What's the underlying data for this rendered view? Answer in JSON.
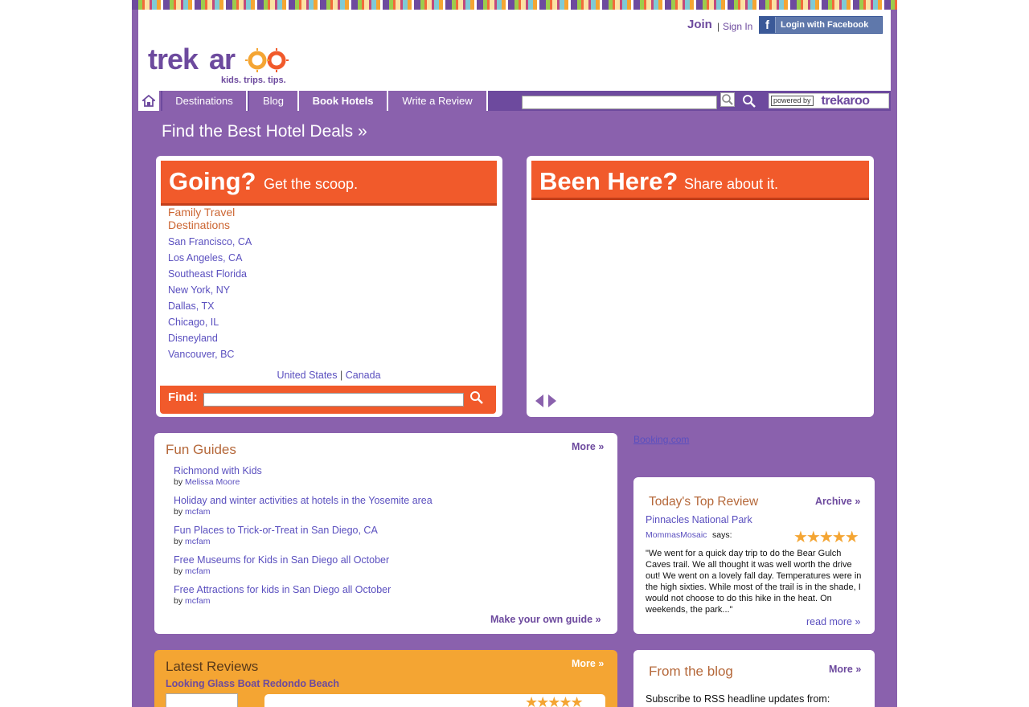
{
  "header": {
    "logo_text": "trekaroo",
    "tagline": "kids. trips. tips.",
    "join_label": "Join",
    "separator": "|",
    "signin_label": "Sign In",
    "facebook_label": "Login with Facebook"
  },
  "nav": {
    "items": [
      {
        "label": "Destinations"
      },
      {
        "label": "Blog"
      },
      {
        "label": "Book Hotels"
      },
      {
        "label": "Write a Review"
      }
    ],
    "search_placeholder": "",
    "powered_by": "powered by",
    "powered_logo": "trekaroo"
  },
  "page": {
    "title": "Find the Best Hotel Deals »"
  },
  "going": {
    "big": "Going?",
    "small": "Get the scoop.",
    "dest_heading": "Family Travel Destinations",
    "destinations": [
      "San Francisco, CA",
      "Los Angeles, CA",
      "Southeast Florida",
      "New York, NY",
      "Dallas, TX",
      "Chicago, IL",
      "Disneyland",
      "Vancouver, BC"
    ],
    "country_us": "United States",
    "country_sep": "|",
    "country_ca": "Canada",
    "find_label": "Find:",
    "find_value": ""
  },
  "been": {
    "big": "Been Here?",
    "small": "Share about it."
  },
  "fun_guides": {
    "heading": "Fun Guides",
    "more": "More »",
    "by": "by",
    "items": [
      {
        "title": "Richmond with Kids",
        "author": "Melissa Moore"
      },
      {
        "title": "Holiday and winter activities at hotels in the Yosemite area",
        "author": "mcfam"
      },
      {
        "title": "Fun Places to Trick-or-Treat in San Diego, CA",
        "author": "mcfam"
      },
      {
        "title": "Free Museums for Kids in San Diego all October",
        "author": "mcfam"
      },
      {
        "title": "Free Attractions for kids in San Diego all October",
        "author": "mcfam"
      }
    ],
    "make_own": "Make your own guide »"
  },
  "booking_link": "Booking.com",
  "top_review": {
    "heading": "Today's Top Review",
    "archive": "Archive »",
    "place": "Pinnacles National Park",
    "user": "MommasMosaic",
    "says": "says:",
    "rating": 5,
    "text": "\"We went for a quick day trip to do the Bear Gulch Caves trail. We all thought it was well worth the drive out! We went on a lovely fall day. Temperatures were in the high sixties. While most of the trail is in the shade, I would not choose to do this hike in the heat. On weekends, the park...\"",
    "read_more": "read more »"
  },
  "latest_reviews": {
    "heading": "Latest Reviews",
    "more": "More »",
    "first_title": "Looking Glass Boat Redondo Beach",
    "first_rating": 5
  },
  "blog": {
    "heading": "From the blog",
    "more": "More »",
    "subscribe": "Subscribe to RSS headline updates from:"
  },
  "colors": {
    "purple": "#8a61ad",
    "dark_purple": "#6d4a9e",
    "orange": "#f15a2b",
    "gold": "#f4a533",
    "link": "#5a4fbf"
  }
}
